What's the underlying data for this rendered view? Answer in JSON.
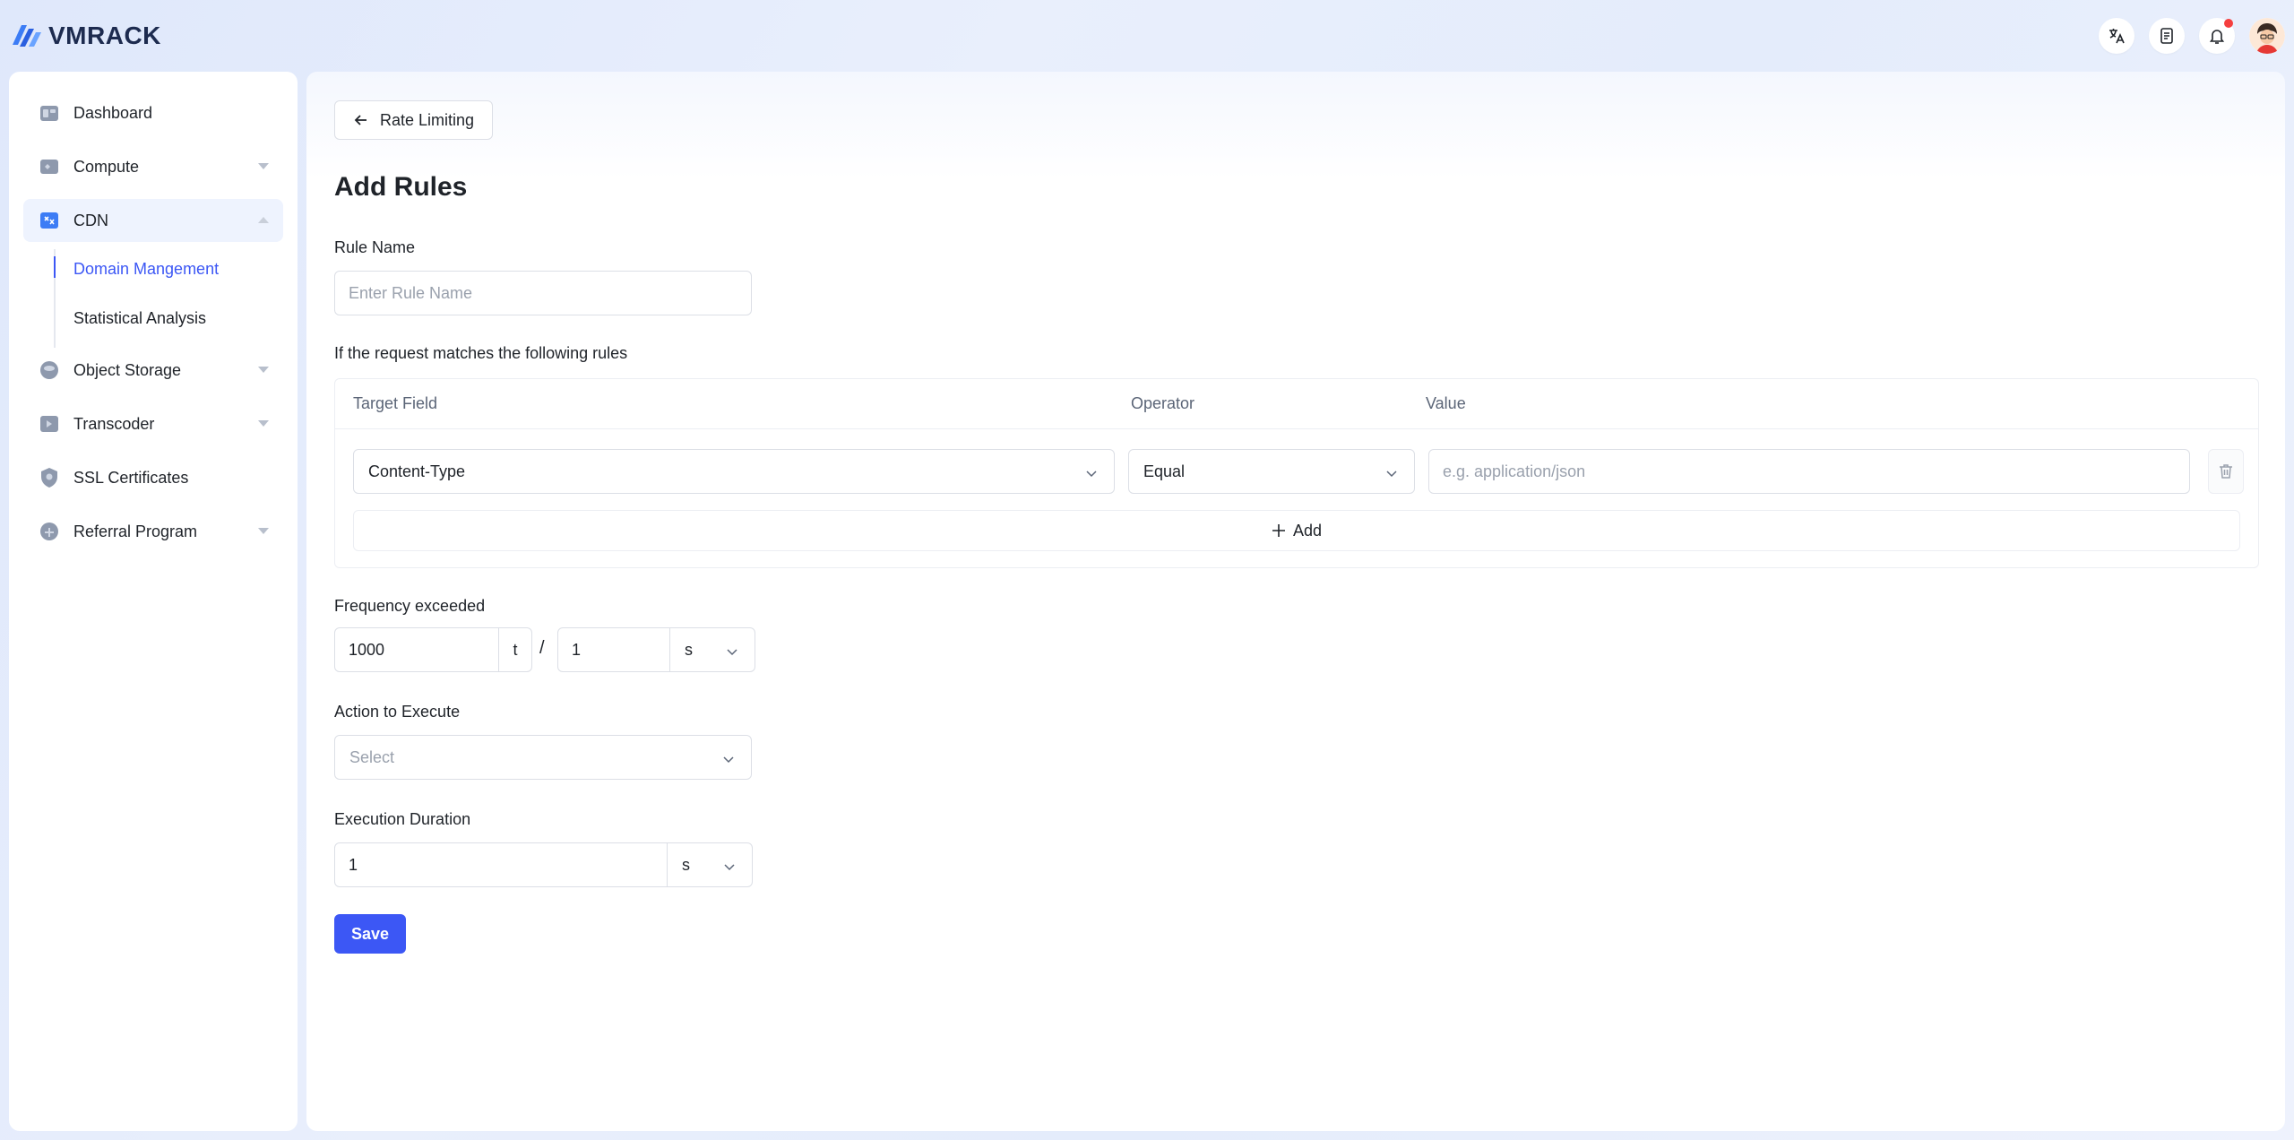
{
  "brand": {
    "name": "VMRACK"
  },
  "header": {
    "icons": [
      "translate-icon",
      "document-icon",
      "bell-icon",
      "avatar"
    ]
  },
  "sidebar": {
    "items": [
      {
        "label": "Dashboard",
        "icon": "dashboard-icon",
        "has_caret": false
      },
      {
        "label": "Compute",
        "icon": "compute-icon",
        "has_caret": true
      },
      {
        "label": "CDN",
        "icon": "cdn-icon",
        "has_caret": true,
        "expanded": true,
        "active": true,
        "children": [
          {
            "label": "Domain Mangement",
            "active": true
          },
          {
            "label": "Statistical Analysis",
            "active": false
          }
        ]
      },
      {
        "label": "Object Storage",
        "icon": "object-storage-icon",
        "has_caret": true
      },
      {
        "label": "Transcoder",
        "icon": "transcoder-icon",
        "has_caret": true
      },
      {
        "label": "SSL Certificates",
        "icon": "ssl-icon",
        "has_caret": false
      },
      {
        "label": "Referral Program",
        "icon": "referral-icon",
        "has_caret": true
      }
    ]
  },
  "main": {
    "back_label": "Rate Limiting",
    "title": "Add Rules",
    "rule_name": {
      "label": "Rule Name",
      "placeholder": "Enter Rule Name",
      "value": ""
    },
    "match_label": "If the request matches the following rules",
    "rules_table": {
      "columns": [
        "Target Field",
        "Operator",
        "Value"
      ],
      "rows": [
        {
          "target_field": "Content-Type",
          "operator": "Equal",
          "value_placeholder": "e.g. application/json",
          "value": ""
        }
      ],
      "add_label": "Add"
    },
    "frequency": {
      "label": "Frequency exceeded",
      "count": "1000",
      "count_unit": "t",
      "separator": "/",
      "period": "1",
      "period_unit": "s"
    },
    "action": {
      "label": "Action to Execute",
      "placeholder": "Select"
    },
    "duration": {
      "label": "Execution Duration",
      "value": "1",
      "unit": "s"
    },
    "save_label": "Save"
  },
  "colors": {
    "accent": "#3c57f5",
    "notification": "#f53f3f",
    "border": "#dcdfe6"
  }
}
